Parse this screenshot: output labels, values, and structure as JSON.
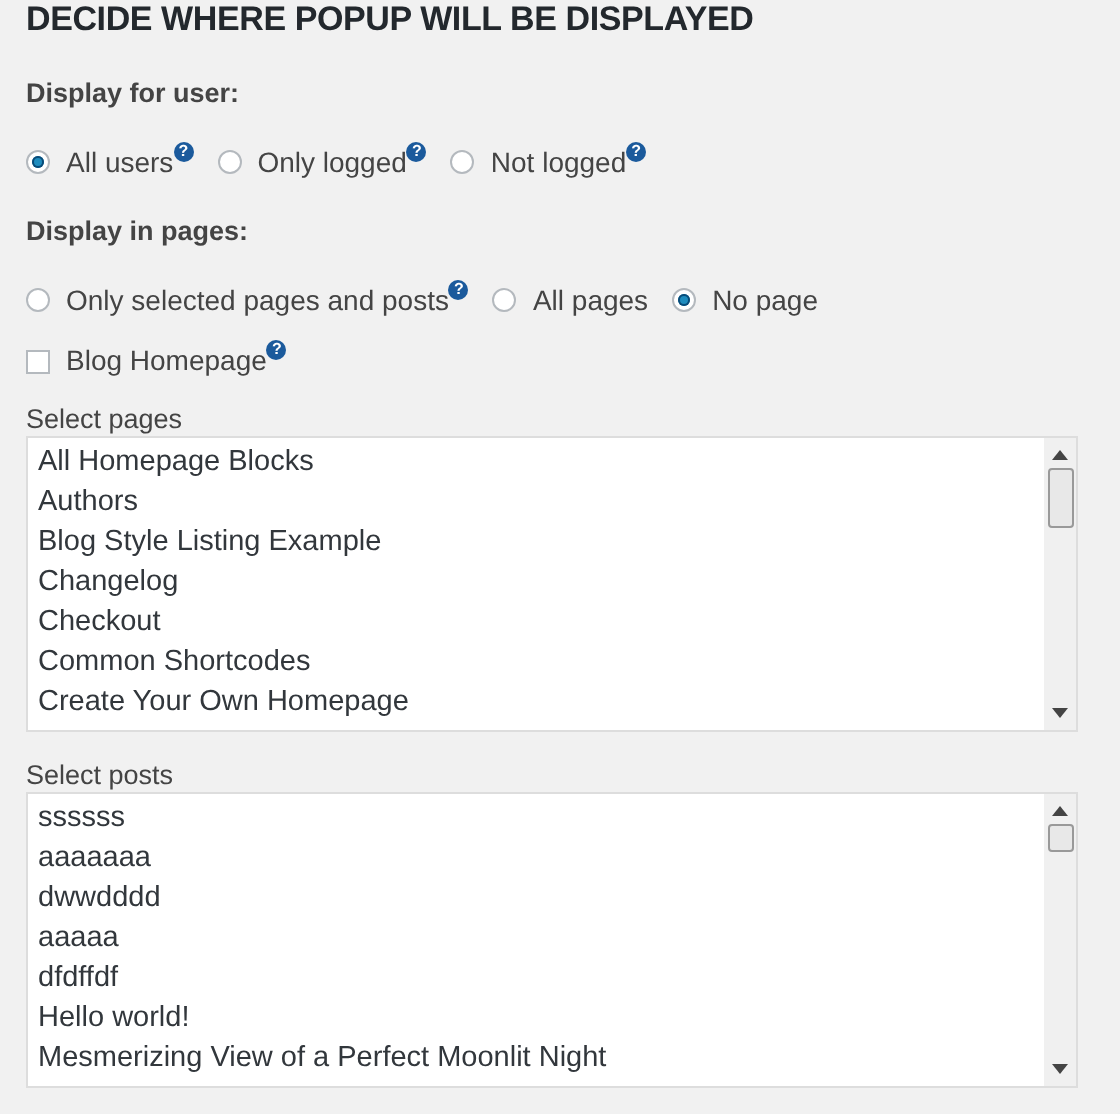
{
  "heading": "DECIDE WHERE POPUP WILL BE DISPLAYED",
  "help_glyph": "?",
  "user_group": {
    "label": "Display for user:",
    "options": [
      {
        "label": "All users",
        "selected": true,
        "help": true
      },
      {
        "label": "Only logged",
        "selected": false,
        "help": true
      },
      {
        "label": "Not logged",
        "selected": false,
        "help": true
      }
    ]
  },
  "pages_group": {
    "label": "Display in pages:",
    "options": [
      {
        "label": "Only selected pages and posts",
        "selected": false,
        "help": true
      },
      {
        "label": "All pages",
        "selected": false,
        "help": false
      },
      {
        "label": "No page",
        "selected": true,
        "help": false
      }
    ]
  },
  "blog_homepage": {
    "label": "Blog Homepage",
    "checked": false,
    "help": true
  },
  "lists": [
    {
      "label": "Select pages",
      "items": [
        "All Homepage Blocks",
        "Authors",
        "Blog Style Listing Example",
        "Changelog",
        "Checkout",
        "Common Shortcodes",
        "Create Your Own Homepage"
      ]
    },
    {
      "label": "Select posts",
      "items": [
        "ssssss",
        "aaaaaaa",
        "dwwdddd",
        "aaaaa",
        "dfdffdf",
        "Hello world!",
        "Mesmerizing View of a Perfect Moonlit Night"
      ]
    }
  ]
}
